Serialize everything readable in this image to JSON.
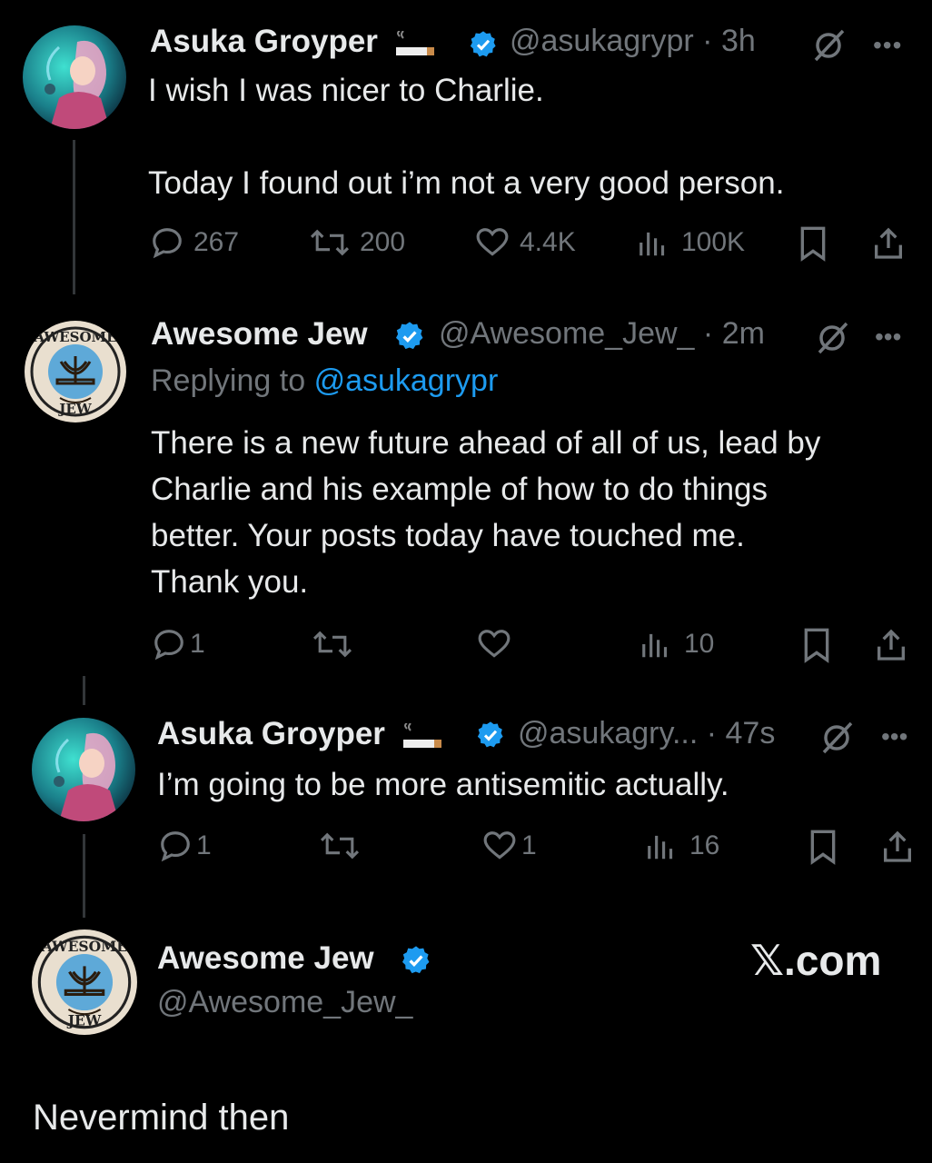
{
  "tweet1": {
    "name": "Asuka Groyper",
    "handle": "@asukagrypr",
    "time": "3h",
    "text": "I wish I was nicer to Charlie.\n\nToday I found out i’m not a very good person.",
    "replies": "267",
    "reposts": "200",
    "likes": "4.4K",
    "views": "100K"
  },
  "tweet2": {
    "name": "Awesome Jew",
    "handle": "@Awesome_Jew_",
    "time": "2m",
    "replying_prefix": "Replying to",
    "replying_handle": "@asukagrypr",
    "text": "There is a new future ahead of all of us, lead by\nCharlie and his example of how to do things\nbetter. Your posts today have touched me.\nThank you.",
    "replies": "1",
    "views": "10"
  },
  "tweet3": {
    "name": "Asuka Groyper",
    "handle": "@asukagry...",
    "time": "47s",
    "text": "I’m going to be more antisemitic actually.",
    "replies": "1",
    "likes": "1",
    "views": "16"
  },
  "quote": {
    "name": "Awesome Jew",
    "handle": "@Awesome_Jew_",
    "brand": "𝕏.com",
    "text": "Nevermind then"
  },
  "badge": {
    "top": "AWESOME",
    "bottom": "JEW"
  },
  "colors": {
    "accent": "#1d9bf0",
    "muted": "#71767b",
    "text": "#e7e9ea"
  }
}
